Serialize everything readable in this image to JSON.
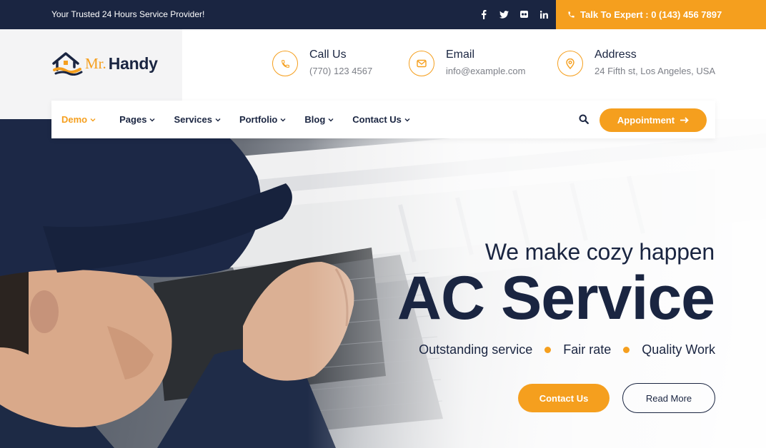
{
  "topbar": {
    "tagline": "Your Trusted 24 Hours Service Provider!",
    "socials": [
      "facebook-icon",
      "twitter-icon",
      "flickr-icon",
      "linkedin-icon"
    ],
    "expert_text": "Talk To Expert : 0 (143) 456 7897"
  },
  "logo": {
    "mr": "Mr.",
    "handy": "Handy"
  },
  "contacts": {
    "call": {
      "title": "Call Us",
      "value": "(770) 123 4567",
      "icon": "phone-icon"
    },
    "email": {
      "title": "Email",
      "value": "info@example.com",
      "icon": "envelope-icon"
    },
    "address": {
      "title": "Address",
      "value": "24 Fifth st, Los Angeles, USA",
      "icon": "map-pin-icon"
    }
  },
  "nav": {
    "items": [
      {
        "label": "Demo",
        "active": true
      },
      {
        "label": "Pages"
      },
      {
        "label": "Services"
      },
      {
        "label": "Portfolio"
      },
      {
        "label": "Blog"
      },
      {
        "label": "Contact Us"
      }
    ],
    "appointment": "Appointment"
  },
  "hero": {
    "subtitle": "We make cozy happen",
    "headline": "AC Service",
    "features": [
      "Outstanding service",
      "Fair rate",
      "Quality Work"
    ],
    "contact_button": "Contact Us",
    "read_more_button": "Read More"
  },
  "colors": {
    "accent": "#f59f1e",
    "navy": "#1a2541"
  }
}
